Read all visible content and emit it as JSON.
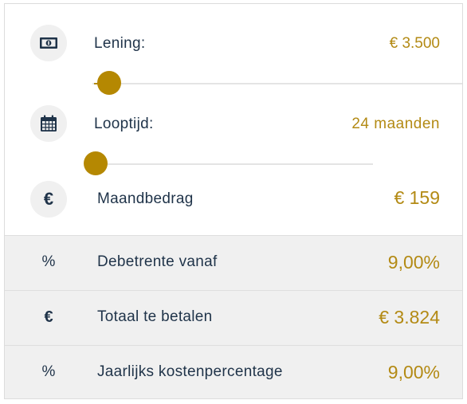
{
  "loan": {
    "label": "Lening:",
    "value": "€ 3.500",
    "slider_level": 0.03
  },
  "term": {
    "label": "Looptijd:",
    "value": "24 maanden",
    "slider_level": 0.0
  },
  "monthly": {
    "symbol": "€",
    "label": "Maandbedrag",
    "value": "€ 159"
  },
  "details": [
    {
      "symbol": "%",
      "label": "Debetrente vanaf",
      "value": "9,00%"
    },
    {
      "symbol": "€",
      "label": "Totaal te betalen",
      "value": "€ 3.824"
    },
    {
      "symbol": "%",
      "label": "Jaarlijks kostenpercentage",
      "value": "9,00%"
    }
  ],
  "icons": {
    "loan": "banknote-icon",
    "term": "calendar-icon",
    "monthly": "euro-icon"
  },
  "colors": {
    "accent": "#b58802",
    "text": "#1f3349",
    "panel_grey": "#f0f0f0"
  }
}
